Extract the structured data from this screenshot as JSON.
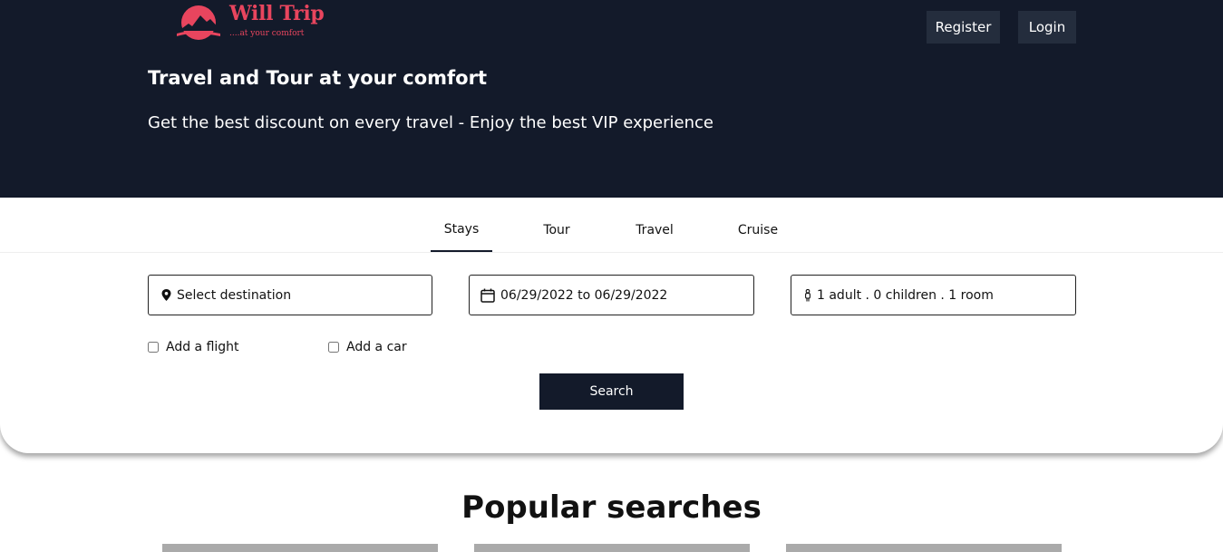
{
  "brand": {
    "name": "Will Trip",
    "tagline": "....at your comfort",
    "color": "#e8455e"
  },
  "header": {
    "register_label": "Register",
    "login_label": "Login",
    "title": "Travel and Tour at your comfort",
    "subtitle": "Get the best discount on every travel - Enjoy the best VIP experience",
    "background": "#131a2a"
  },
  "tabs": [
    {
      "label": "Stays",
      "active": true
    },
    {
      "label": "Tour",
      "active": false
    },
    {
      "label": "Travel",
      "active": false
    },
    {
      "label": "Cruise",
      "active": false
    }
  ],
  "search": {
    "destination_label": "Select destination",
    "date_range": "06/29/2022 to 06/29/2022",
    "guests": "1 adult . 0 children . 1 room",
    "add_flight_label": "Add a flight",
    "add_flight_checked": false,
    "add_car_label": "Add a car",
    "add_car_checked": false,
    "button_label": "Search"
  },
  "popular": {
    "title": "Popular searches"
  },
  "icons": {
    "destination": "map-pin-icon",
    "date": "calendar-icon",
    "guests": "person-icon"
  }
}
